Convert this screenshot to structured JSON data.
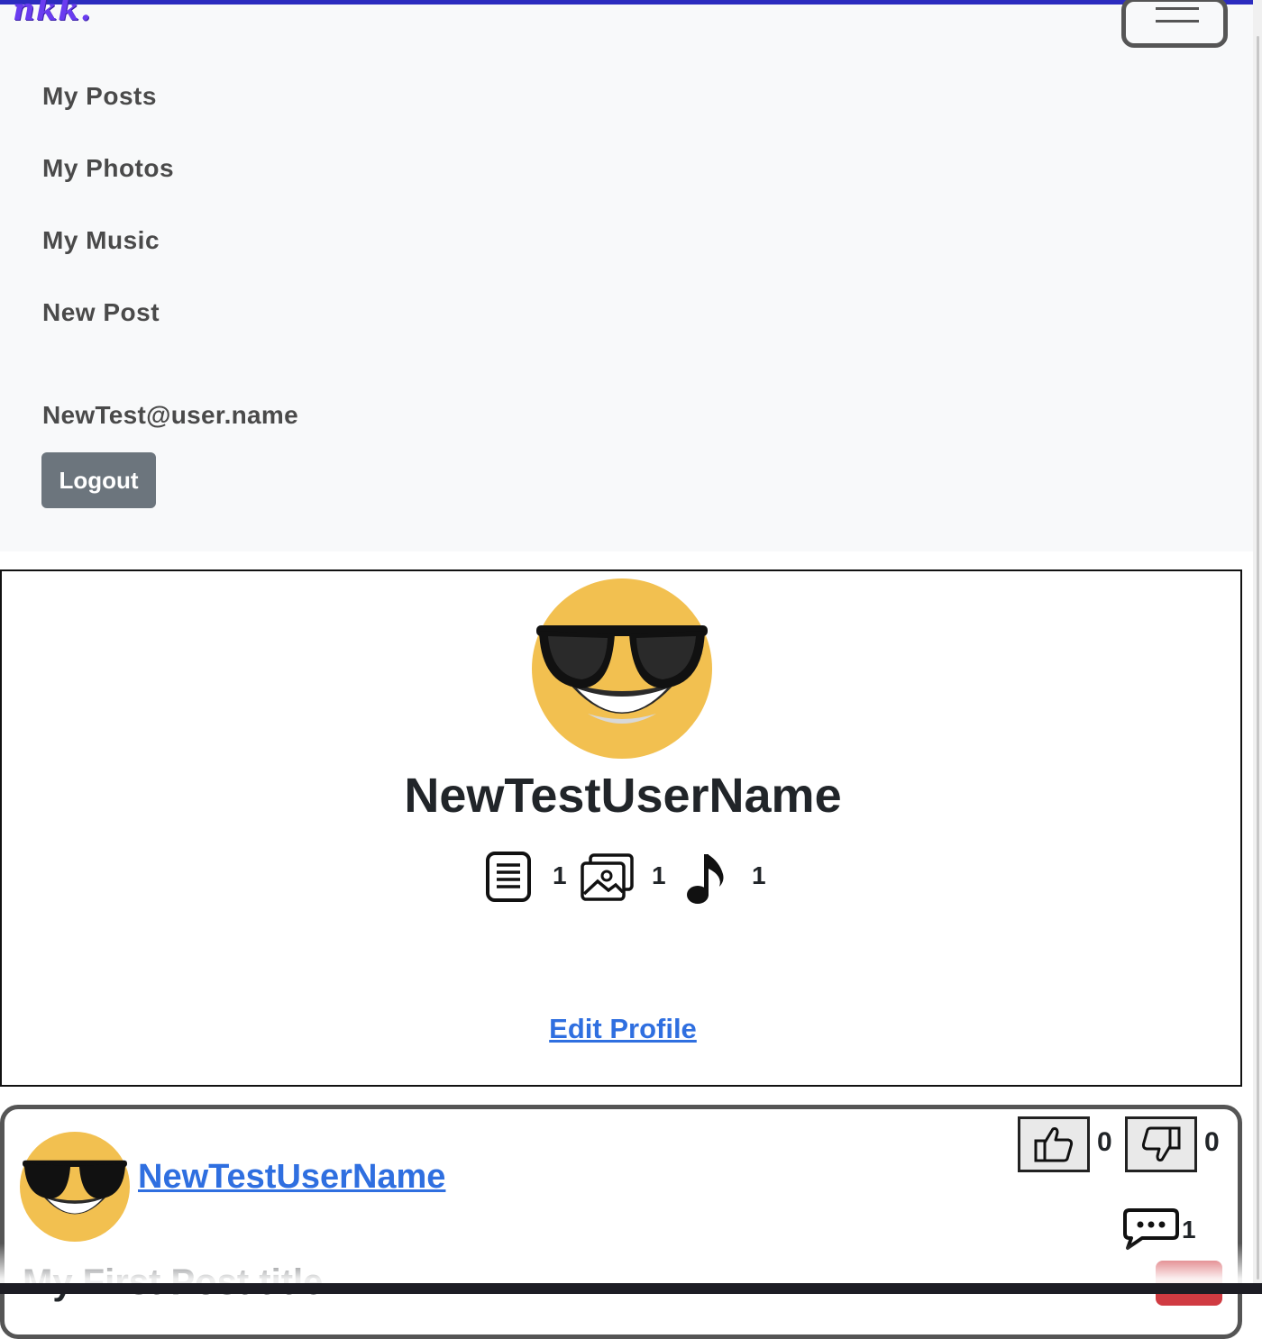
{
  "brand": {
    "logo_text": "nkk."
  },
  "nav": {
    "items": [
      {
        "label": "My Posts"
      },
      {
        "label": "My Photos"
      },
      {
        "label": "My Music"
      },
      {
        "label": "New Post"
      }
    ],
    "user_email": "NewTest@user.name",
    "logout_label": "Logout"
  },
  "profile": {
    "name": "NewTestUserName",
    "stats": {
      "posts": "1",
      "photos": "1",
      "music": "1"
    },
    "edit_label": "Edit Profile"
  },
  "post": {
    "author": "NewTestUserName",
    "likes": "0",
    "dislikes": "0",
    "comments": "1",
    "title": "My First Post title"
  },
  "colors": {
    "accent_link": "#2f6fe0",
    "logout_bg": "#6c757d",
    "navbar_bg": "#f8f9fa",
    "brand": "#6a3cf0",
    "delete_bg": "#d03b42"
  },
  "icons": [
    "hamburger-menu-icon",
    "document-icon",
    "photos-icon",
    "music-note-icon",
    "thumbs-up-icon",
    "thumbs-down-icon",
    "comment-icon"
  ]
}
